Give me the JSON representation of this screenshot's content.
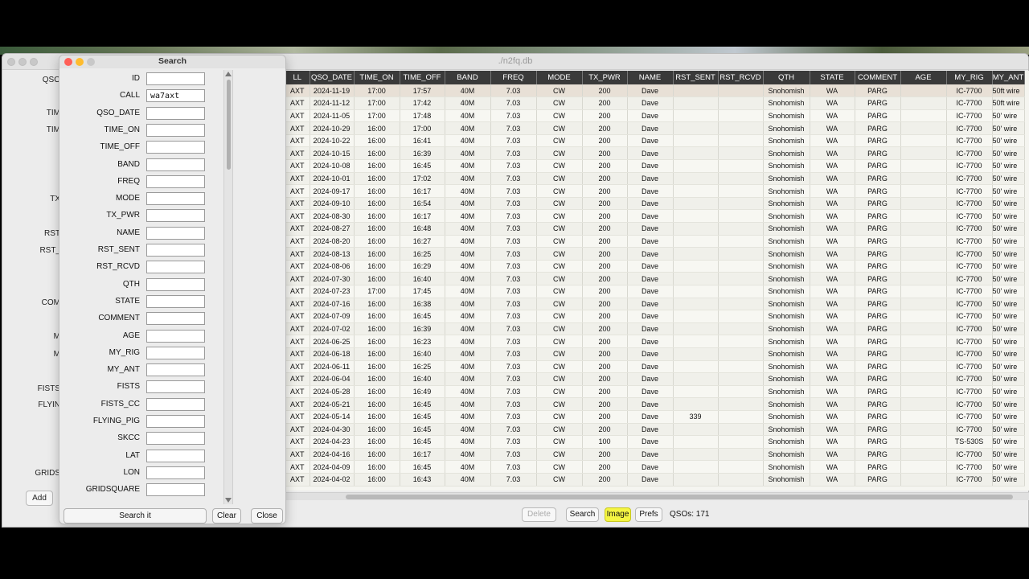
{
  "main_window": {
    "title": "./n2fq.db",
    "bg_form_labels": [
      "QSO",
      "TIM",
      "TIM",
      "TX",
      "RST",
      "RST_",
      "COM",
      "M",
      "M",
      "FISTS",
      "FLYIN",
      "GRIDS"
    ],
    "add_label": "Add"
  },
  "table": {
    "columns": [
      "LL",
      "QSO_DATE",
      "TIME_ON",
      "TIME_OFF",
      "BAND",
      "FREQ",
      "MODE",
      "TX_PWR",
      "NAME",
      "RST_SENT",
      "RST_RCVD",
      "QTH",
      "STATE",
      "COMMENT",
      "AGE",
      "MY_RIG",
      "MY_ANT"
    ],
    "rows": [
      [
        "AXT",
        "2024-11-19",
        "17:00",
        "17:57",
        "40M",
        "7.03",
        "CW",
        "200",
        "Dave",
        "",
        "",
        "Snohomish",
        "WA",
        "PARG",
        "",
        "IC-7700",
        "50ft wire"
      ],
      [
        "AXT",
        "2024-11-12",
        "17:00",
        "17:42",
        "40M",
        "7.03",
        "CW",
        "200",
        "Dave",
        "",
        "",
        "Snohomish",
        "WA",
        "PARG",
        "",
        "IC-7700",
        "50ft wire"
      ],
      [
        "AXT",
        "2024-11-05",
        "17:00",
        "17:48",
        "40M",
        "7.03",
        "CW",
        "200",
        "Dave",
        "",
        "",
        "Snohomish",
        "WA",
        "PARG",
        "",
        "IC-7700",
        "50' wire"
      ],
      [
        "AXT",
        "2024-10-29",
        "16:00",
        "17:00",
        "40M",
        "7.03",
        "CW",
        "200",
        "Dave",
        "",
        "",
        "Snohomish",
        "WA",
        "PARG",
        "",
        "IC-7700",
        "50' wire"
      ],
      [
        "AXT",
        "2024-10-22",
        "16:00",
        "16:41",
        "40M",
        "7.03",
        "CW",
        "200",
        "Dave",
        "",
        "",
        "Snohomish",
        "WA",
        "PARG",
        "",
        "IC-7700",
        "50' wire"
      ],
      [
        "AXT",
        "2024-10-15",
        "16:00",
        "16:39",
        "40M",
        "7.03",
        "CW",
        "200",
        "Dave",
        "",
        "",
        "Snohomish",
        "WA",
        "PARG",
        "",
        "IC-7700",
        "50' wire"
      ],
      [
        "AXT",
        "2024-10-08",
        "16:00",
        "16:45",
        "40M",
        "7.03",
        "CW",
        "200",
        "Dave",
        "",
        "",
        "Snohomish",
        "WA",
        "PARG",
        "",
        "IC-7700",
        "50' wire"
      ],
      [
        "AXT",
        "2024-10-01",
        "16:00",
        "17:02",
        "40M",
        "7.03",
        "CW",
        "200",
        "Dave",
        "",
        "",
        "Snohomish",
        "WA",
        "PARG",
        "",
        "IC-7700",
        "50' wire"
      ],
      [
        "AXT",
        "2024-09-17",
        "16:00",
        "16:17",
        "40M",
        "7.03",
        "CW",
        "200",
        "Dave",
        "",
        "",
        "Snohomish",
        "WA",
        "PARG",
        "",
        "IC-7700",
        "50' wire"
      ],
      [
        "AXT",
        "2024-09-10",
        "16:00",
        "16:54",
        "40M",
        "7.03",
        "CW",
        "200",
        "Dave",
        "",
        "",
        "Snohomish",
        "WA",
        "PARG",
        "",
        "IC-7700",
        "50' wire"
      ],
      [
        "AXT",
        "2024-08-30",
        "16:00",
        "16:17",
        "40M",
        "7.03",
        "CW",
        "200",
        "Dave",
        "",
        "",
        "Snohomish",
        "WA",
        "PARG",
        "",
        "IC-7700",
        "50' wire"
      ],
      [
        "AXT",
        "2024-08-27",
        "16:00",
        "16:48",
        "40M",
        "7.03",
        "CW",
        "200",
        "Dave",
        "",
        "",
        "Snohomish",
        "WA",
        "PARG",
        "",
        "IC-7700",
        "50' wire"
      ],
      [
        "AXT",
        "2024-08-20",
        "16:00",
        "16:27",
        "40M",
        "7.03",
        "CW",
        "200",
        "Dave",
        "",
        "",
        "Snohomish",
        "WA",
        "PARG",
        "",
        "IC-7700",
        "50' wire"
      ],
      [
        "AXT",
        "2024-08-13",
        "16:00",
        "16:25",
        "40M",
        "7.03",
        "CW",
        "200",
        "Dave",
        "",
        "",
        "Snohomish",
        "WA",
        "PARG",
        "",
        "IC-7700",
        "50' wire"
      ],
      [
        "AXT",
        "2024-08-06",
        "16:00",
        "16:29",
        "40M",
        "7.03",
        "CW",
        "200",
        "Dave",
        "",
        "",
        "Snohomish",
        "WA",
        "PARG",
        "",
        "IC-7700",
        "50' wire"
      ],
      [
        "AXT",
        "2024-07-30",
        "16:00",
        "16:40",
        "40M",
        "7.03",
        "CW",
        "200",
        "Dave",
        "",
        "",
        "Snohomish",
        "WA",
        "PARG",
        "",
        "IC-7700",
        "50' wire"
      ],
      [
        "AXT",
        "2024-07-23",
        "17:00",
        "17:45",
        "40M",
        "7.03",
        "CW",
        "200",
        "Dave",
        "",
        "",
        "Snohomish",
        "WA",
        "PARG",
        "",
        "IC-7700",
        "50' wire"
      ],
      [
        "AXT",
        "2024-07-16",
        "16:00",
        "16:38",
        "40M",
        "7.03",
        "CW",
        "200",
        "Dave",
        "",
        "",
        "Snohomish",
        "WA",
        "PARG",
        "",
        "IC-7700",
        "50' wire"
      ],
      [
        "AXT",
        "2024-07-09",
        "16:00",
        "16:45",
        "40M",
        "7.03",
        "CW",
        "200",
        "Dave",
        "",
        "",
        "Snohomish",
        "WA",
        "PARG",
        "",
        "IC-7700",
        "50' wire"
      ],
      [
        "AXT",
        "2024-07-02",
        "16:00",
        "16:39",
        "40M",
        "7.03",
        "CW",
        "200",
        "Dave",
        "",
        "",
        "Snohomish",
        "WA",
        "PARG",
        "",
        "IC-7700",
        "50' wire"
      ],
      [
        "AXT",
        "2024-06-25",
        "16:00",
        "16:23",
        "40M",
        "7.03",
        "CW",
        "200",
        "Dave",
        "",
        "",
        "Snohomish",
        "WA",
        "PARG",
        "",
        "IC-7700",
        "50' wire"
      ],
      [
        "AXT",
        "2024-06-18",
        "16:00",
        "16:40",
        "40M",
        "7.03",
        "CW",
        "200",
        "Dave",
        "",
        "",
        "Snohomish",
        "WA",
        "PARG",
        "",
        "IC-7700",
        "50' wire"
      ],
      [
        "AXT",
        "2024-06-11",
        "16:00",
        "16:25",
        "40M",
        "7.03",
        "CW",
        "200",
        "Dave",
        "",
        "",
        "Snohomish",
        "WA",
        "PARG",
        "",
        "IC-7700",
        "50' wire"
      ],
      [
        "AXT",
        "2024-06-04",
        "16:00",
        "16:40",
        "40M",
        "7.03",
        "CW",
        "200",
        "Dave",
        "",
        "",
        "Snohomish",
        "WA",
        "PARG",
        "",
        "IC-7700",
        "50' wire"
      ],
      [
        "AXT",
        "2024-05-28",
        "16:00",
        "16:49",
        "40M",
        "7.03",
        "CW",
        "200",
        "Dave",
        "",
        "",
        "Snohomish",
        "WA",
        "PARG",
        "",
        "IC-7700",
        "50' wire"
      ],
      [
        "AXT",
        "2024-05-21",
        "16:00",
        "16:45",
        "40M",
        "7.03",
        "CW",
        "200",
        "Dave",
        "",
        "",
        "Snohomish",
        "WA",
        "PARG",
        "",
        "IC-7700",
        "50' wire"
      ],
      [
        "AXT",
        "2024-05-14",
        "16:00",
        "16:45",
        "40M",
        "7.03",
        "CW",
        "200",
        "Dave",
        "339",
        "",
        "Snohomish",
        "WA",
        "PARG",
        "",
        "IC-7700",
        "50' wire"
      ],
      [
        "AXT",
        "2024-04-30",
        "16:00",
        "16:45",
        "40M",
        "7.03",
        "CW",
        "200",
        "Dave",
        "",
        "",
        "Snohomish",
        "WA",
        "PARG",
        "",
        "IC-7700",
        "50' wire"
      ],
      [
        "AXT",
        "2024-04-23",
        "16:00",
        "16:45",
        "40M",
        "7.03",
        "CW",
        "100",
        "Dave",
        "",
        "",
        "Snohomish",
        "WA",
        "PARG",
        "",
        "TS-530S",
        "50' wire"
      ],
      [
        "AXT",
        "2024-04-16",
        "16:00",
        "16:17",
        "40M",
        "7.03",
        "CW",
        "200",
        "Dave",
        "",
        "",
        "Snohomish",
        "WA",
        "PARG",
        "",
        "IC-7700",
        "50' wire"
      ],
      [
        "AXT",
        "2024-04-09",
        "16:00",
        "16:45",
        "40M",
        "7.03",
        "CW",
        "200",
        "Dave",
        "",
        "",
        "Snohomish",
        "WA",
        "PARG",
        "",
        "IC-7700",
        "50' wire"
      ],
      [
        "AXT",
        "2024-04-02",
        "16:00",
        "16:43",
        "40M",
        "7.03",
        "CW",
        "200",
        "Dave",
        "",
        "",
        "Snohomish",
        "WA",
        "PARG",
        "",
        "IC-7700",
        "50' wire"
      ]
    ]
  },
  "toolbar": {
    "delete_label": "Delete",
    "search_label": "Search",
    "image_label": "Image",
    "prefs_label": "Prefs",
    "qso_count": "QSOs: 171",
    "image_highlight": "#f5f542"
  },
  "search_dialog": {
    "title": "Search",
    "fields": [
      {
        "label": "ID",
        "value": ""
      },
      {
        "label": "CALL",
        "value": "wa7axt"
      },
      {
        "label": "QSO_DATE",
        "value": ""
      },
      {
        "label": "TIME_ON",
        "value": ""
      },
      {
        "label": "TIME_OFF",
        "value": ""
      },
      {
        "label": "BAND",
        "value": ""
      },
      {
        "label": "FREQ",
        "value": ""
      },
      {
        "label": "MODE",
        "value": ""
      },
      {
        "label": "TX_PWR",
        "value": ""
      },
      {
        "label": "NAME",
        "value": ""
      },
      {
        "label": "RST_SENT",
        "value": ""
      },
      {
        "label": "RST_RCVD",
        "value": ""
      },
      {
        "label": "QTH",
        "value": ""
      },
      {
        "label": "STATE",
        "value": ""
      },
      {
        "label": "COMMENT",
        "value": ""
      },
      {
        "label": "AGE",
        "value": ""
      },
      {
        "label": "MY_RIG",
        "value": ""
      },
      {
        "label": "MY_ANT",
        "value": ""
      },
      {
        "label": "FISTS",
        "value": ""
      },
      {
        "label": "FISTS_CC",
        "value": ""
      },
      {
        "label": "FLYING_PIG",
        "value": ""
      },
      {
        "label": "SKCC",
        "value": ""
      },
      {
        "label": "LAT",
        "value": ""
      },
      {
        "label": "LON",
        "value": ""
      },
      {
        "label": "GRIDSQUARE",
        "value": ""
      }
    ],
    "search_it_label": "Search it",
    "clear_label": "Clear",
    "close_label": "Close"
  },
  "colors": {
    "close_red": "#ff5f57",
    "minimize_yellow": "#febc2e",
    "zoom_gray": "#c8c8c8",
    "header_bg": "#3a3a3a"
  }
}
